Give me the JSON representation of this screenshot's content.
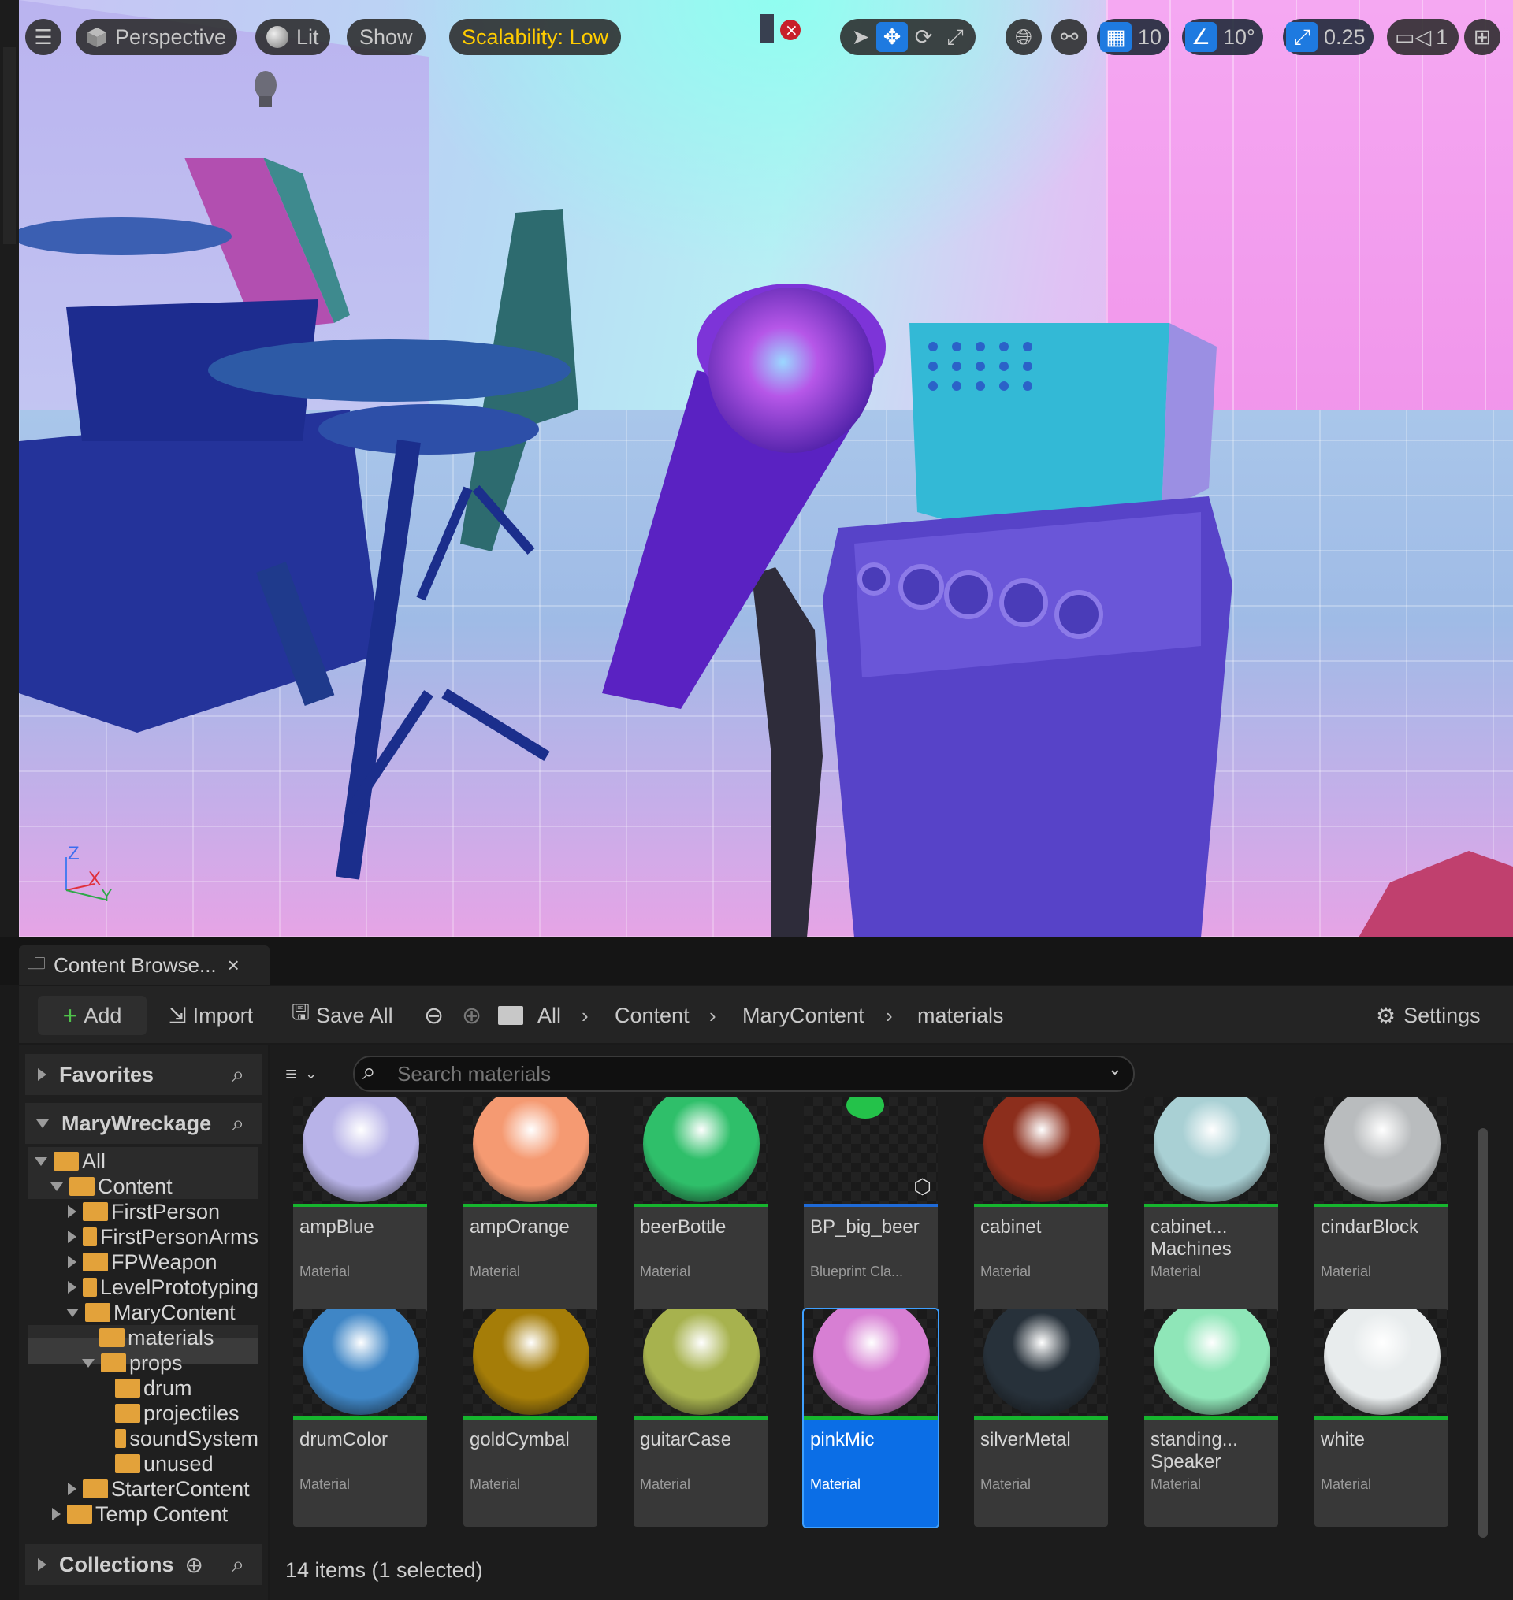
{
  "viewport": {
    "mode_label": "Perspective",
    "lit_label": "Lit",
    "show_label": "Show",
    "scalability_label": "Scalability: Low",
    "grid_snap_value": "10",
    "rotation_snap_value": "10°",
    "scale_snap_value": "0.25",
    "camera_speed_value": "1",
    "axis_labels": {
      "z": "Z",
      "x": "X",
      "y": "Y"
    },
    "accent_color": "#1e7ae0",
    "scalability_color": "#ffcc00"
  },
  "content_browser": {
    "tab_title": "Content Browse...",
    "toolbar": {
      "add_label": "Add",
      "import_label": "Import",
      "save_all_label": "Save All",
      "settings_label": "Settings"
    },
    "breadcrumb": [
      "All",
      "Content",
      "MaryContent",
      "materials"
    ],
    "search_placeholder": "Search materials",
    "sections": {
      "favorites": "Favorites",
      "project": "MaryWreckage",
      "collections": "Collections"
    },
    "tree": [
      {
        "label": "All",
        "expanded": true
      },
      {
        "label": "Content",
        "expanded": true
      },
      {
        "label": "FirstPerson"
      },
      {
        "label": "FirstPersonArms"
      },
      {
        "label": "FPWeapon"
      },
      {
        "label": "LevelPrototyping"
      },
      {
        "label": "MaryContent",
        "expanded": true
      },
      {
        "label": "materials",
        "selected": true
      },
      {
        "label": "props",
        "expanded": true
      },
      {
        "label": "drum"
      },
      {
        "label": "projectiles"
      },
      {
        "label": "soundSystem"
      },
      {
        "label": "unused"
      },
      {
        "label": "StarterContent"
      },
      {
        "label": "Temp Content"
      }
    ],
    "assets": [
      {
        "name": "ampBlue",
        "type": "Material",
        "color": "#b8b3e8"
      },
      {
        "name": "ampOrange",
        "type": "Material",
        "color": "#f59a72"
      },
      {
        "name": "beerBottle",
        "type": "Material",
        "color": "#2fbf6a"
      },
      {
        "name": "BP_big_beer",
        "type": "Blueprint Cla...",
        "color": "#24c24a"
      },
      {
        "name": "cabinet",
        "type": "Material",
        "color": "#8c2e1c"
      },
      {
        "name": "cabinet...\nMachines",
        "type": "Material",
        "color": "#a9d0d4"
      },
      {
        "name": "cindarBlock",
        "type": "Material",
        "color": "#b9bcbe"
      },
      {
        "name": "drumColor",
        "type": "Material",
        "color": "#3f86c6"
      },
      {
        "name": "goldCymbal",
        "type": "Material",
        "color": "#a57d08"
      },
      {
        "name": "guitarCase",
        "type": "Material",
        "color": "#a7b24e"
      },
      {
        "name": "pinkMic",
        "type": "Material",
        "color": "#d77fd3"
      },
      {
        "name": "silverMetal",
        "type": "Material",
        "color": "#27313a"
      },
      {
        "name": "standing...\nSpeaker",
        "type": "Material",
        "color": "#8fe6b8"
      },
      {
        "name": "white",
        "type": "Material",
        "color": "#e8eced"
      }
    ],
    "status_text": "14 items (1 selected)",
    "selection_color": "#0b6ee6",
    "asset_bar_color": "#16b52e"
  }
}
